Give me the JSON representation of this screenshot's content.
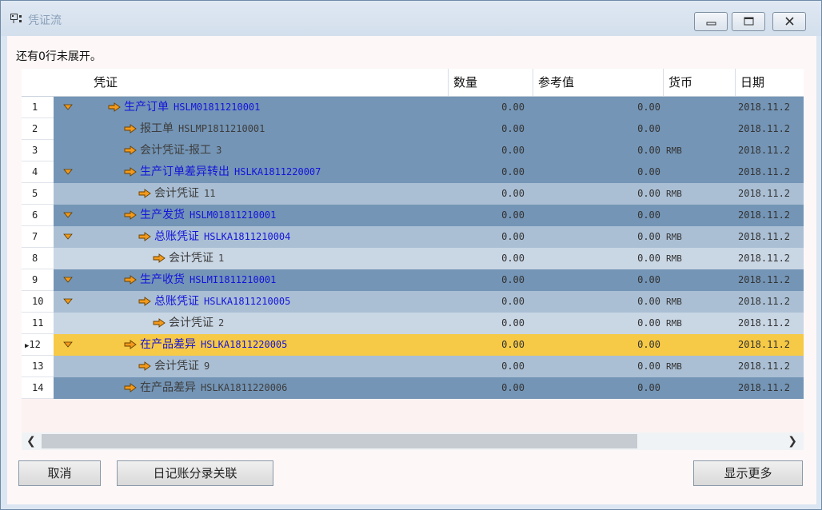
{
  "window": {
    "title": "凭证流",
    "icon": "flow-icon"
  },
  "hint": "还有0行未展开。",
  "columns": [
    "凭证",
    "数量",
    "参考值",
    "货币",
    "日期"
  ],
  "rows": [
    {
      "n": "1",
      "style": "dark",
      "expand": true,
      "indent": 0,
      "label": "生产订单",
      "doc": "HSLM01811210001",
      "color": "blue",
      "qty": "0.00",
      "ref": "0.00",
      "cur": "",
      "date": "2018.11.2"
    },
    {
      "n": "2",
      "style": "dark",
      "expand": false,
      "indent": 1,
      "label": "报工单",
      "doc": "HSLMP1811210001",
      "color": "gray",
      "qty": "0.00",
      "ref": "0.00",
      "cur": "",
      "date": "2018.11.2"
    },
    {
      "n": "3",
      "style": "dark",
      "expand": false,
      "indent": 1,
      "label": "会计凭证-报工",
      "doc": "3",
      "color": "gray",
      "qty": "0.00",
      "ref": "0.00",
      "cur": "RMB",
      "date": "2018.11.2"
    },
    {
      "n": "4",
      "style": "dark",
      "expand": true,
      "indent": 1,
      "label": "生产订单差异转出",
      "doc": "HSLKA1811220007",
      "color": "blue",
      "qty": "0.00",
      "ref": "0.00",
      "cur": "",
      "date": "2018.11.2"
    },
    {
      "n": "5",
      "style": "light",
      "expand": false,
      "indent": 2,
      "label": "会计凭证",
      "doc": "11",
      "color": "gray",
      "qty": "0.00",
      "ref": "0.00",
      "cur": "RMB",
      "date": "2018.11.2"
    },
    {
      "n": "6",
      "style": "dark",
      "expand": true,
      "indent": 1,
      "label": "生产发货",
      "doc": "HSLM01811210001",
      "color": "blue",
      "qty": "0.00",
      "ref": "0.00",
      "cur": "",
      "date": "2018.11.2"
    },
    {
      "n": "7",
      "style": "light",
      "expand": true,
      "indent": 2,
      "label": "总账凭证",
      "doc": "HSLKA1811210004",
      "color": "blue",
      "qty": "0.00",
      "ref": "0.00",
      "cur": "RMB",
      "date": "2018.11.2"
    },
    {
      "n": "8",
      "style": "vlight",
      "expand": false,
      "indent": 3,
      "label": "会计凭证",
      "doc": "1",
      "color": "gray",
      "qty": "0.00",
      "ref": "0.00",
      "cur": "RMB",
      "date": "2018.11.2"
    },
    {
      "n": "9",
      "style": "dark",
      "expand": true,
      "indent": 1,
      "label": "生产收货",
      "doc": "HSLMI1811210001",
      "color": "blue",
      "qty": "0.00",
      "ref": "0.00",
      "cur": "",
      "date": "2018.11.2"
    },
    {
      "n": "10",
      "style": "light",
      "expand": true,
      "indent": 2,
      "label": "总账凭证",
      "doc": "HSLKA1811210005",
      "color": "blue",
      "qty": "0.00",
      "ref": "0.00",
      "cur": "RMB",
      "date": "2018.11.2"
    },
    {
      "n": "11",
      "style": "vlight",
      "expand": false,
      "indent": 3,
      "label": "会计凭证",
      "doc": "2",
      "color": "gray",
      "qty": "0.00",
      "ref": "0.00",
      "cur": "RMB",
      "date": "2018.11.2"
    },
    {
      "n": "12",
      "style": "sel",
      "expand": true,
      "indent": 1,
      "label": "在产品差异",
      "doc": "HSLKA1811220005",
      "color": "blue",
      "qty": "0.00",
      "ref": "0.00",
      "cur": "",
      "date": "2018.11.2",
      "current": true
    },
    {
      "n": "13",
      "style": "light",
      "expand": false,
      "indent": 2,
      "label": "会计凭证",
      "doc": "9",
      "color": "gray",
      "qty": "0.00",
      "ref": "0.00",
      "cur": "RMB",
      "date": "2018.11.2"
    },
    {
      "n": "14",
      "style": "dark",
      "expand": false,
      "indent": 1,
      "label": "在产品差异",
      "doc": "HSLKA1811220006",
      "color": "gray",
      "qty": "0.00",
      "ref": "0.00",
      "cur": "",
      "date": "2018.11.2"
    }
  ],
  "buttons": {
    "cancel": "取消",
    "journal": "日记账分录关联",
    "more": "显示更多"
  },
  "colors": {
    "row_dark": "#7495b6",
    "row_light": "#aabfd4",
    "row_selected": "#f6c946",
    "link_blue": "#1414d9",
    "arrow_orange": "#f39a1c"
  }
}
